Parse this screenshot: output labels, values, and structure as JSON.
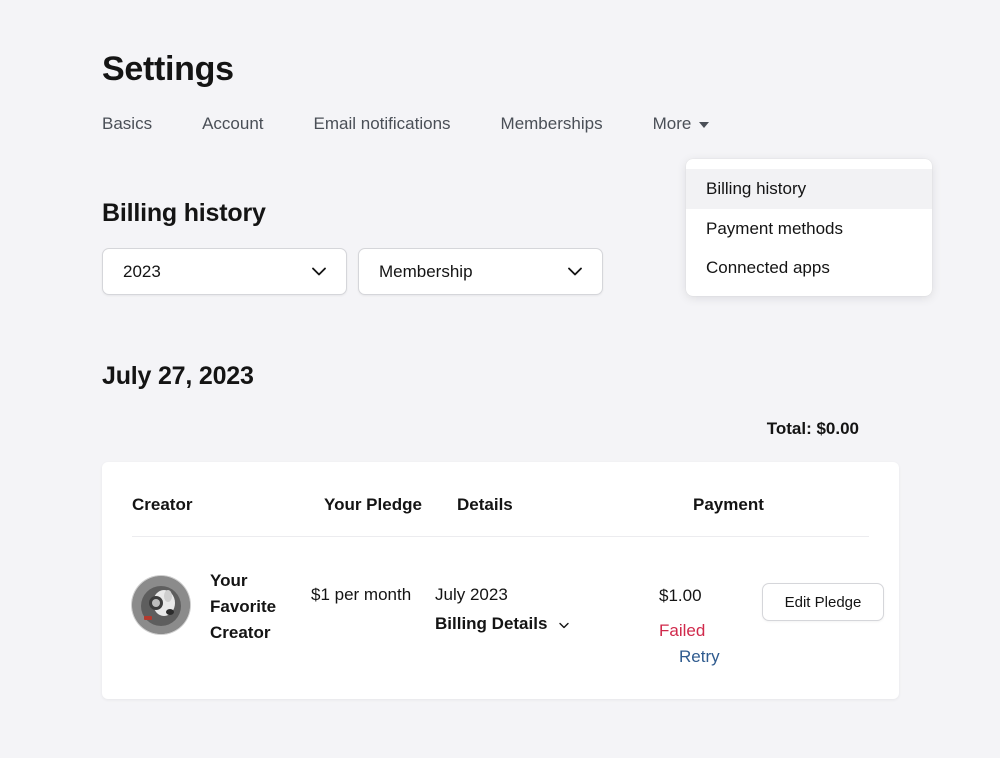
{
  "page": {
    "title": "Settings"
  },
  "tabs": [
    {
      "label": "Basics"
    },
    {
      "label": "Account"
    },
    {
      "label": "Email notifications"
    },
    {
      "label": "Memberships"
    },
    {
      "label": "More"
    }
  ],
  "more_menu": {
    "items": [
      {
        "label": "Billing history",
        "active": true
      },
      {
        "label": "Payment methods",
        "active": false
      },
      {
        "label": "Connected apps",
        "active": false
      }
    ]
  },
  "billing": {
    "title": "Billing history",
    "filters": {
      "year": "2023",
      "type": "Membership"
    },
    "groups": [
      {
        "date": "July 27, 2023",
        "total": "Total: $0.00",
        "columns": {
          "creator": "Creator",
          "pledge": "Your Pledge",
          "details": "Details",
          "payment": "Payment"
        },
        "rows": [
          {
            "creator_name": "Your Favorite Creator",
            "pledge": "$1 per month",
            "details_date": "July 2023",
            "details_link": "Billing Details",
            "amount": "$1.00",
            "status": "Failed",
            "retry_label": "Retry",
            "edit_label": "Edit Pledge"
          }
        ]
      }
    ]
  },
  "colors": {
    "background": "#f4f4f7",
    "failed": "#d0294b",
    "link": "#2f5b8f"
  },
  "icons": {
    "more_caret": "caret-down-icon",
    "select_chevron": "chevron-down-icon",
    "details_chevron": "chevron-down-icon"
  }
}
